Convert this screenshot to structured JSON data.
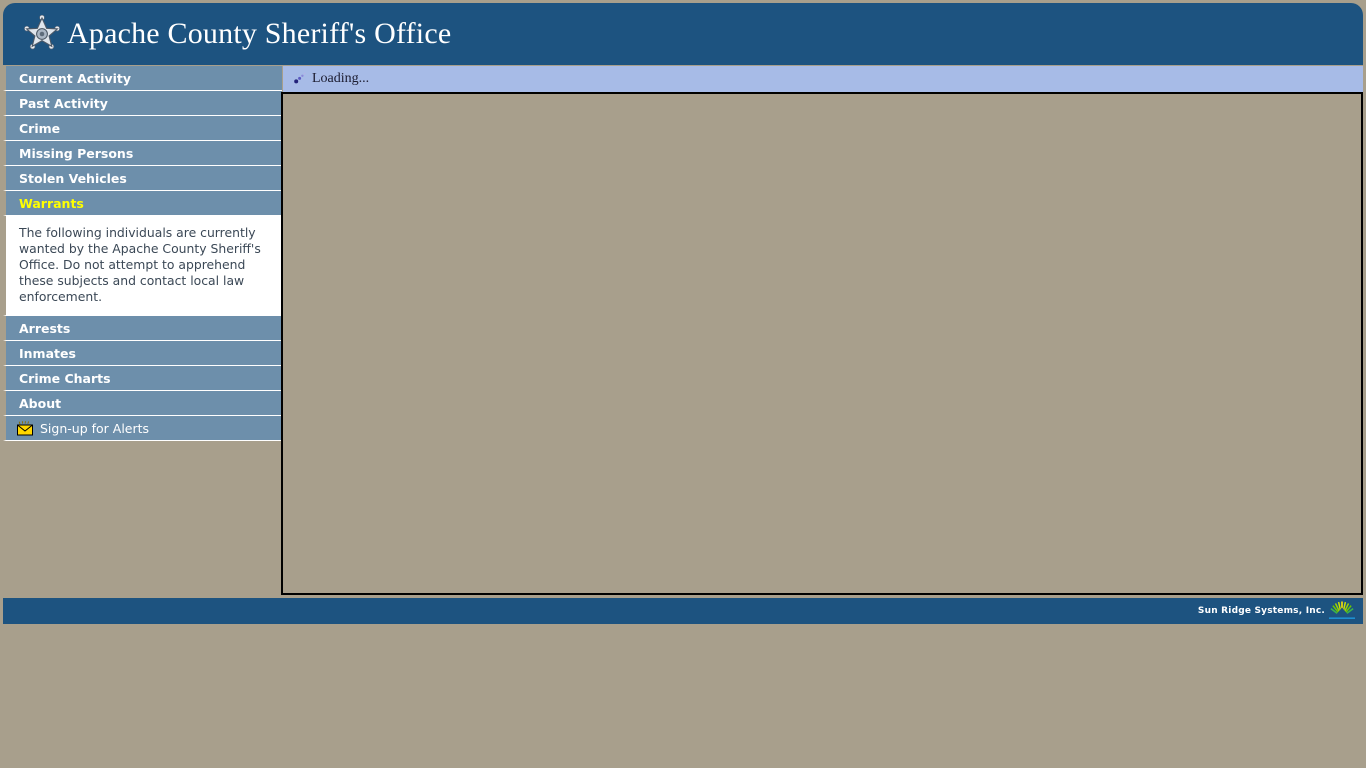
{
  "header": {
    "title": "Apache County Sheriff's Office",
    "badge_icon": "sheriff-star-badge-icon",
    "bg_color": "#1d5380"
  },
  "sidebar": {
    "items": [
      {
        "label": "Current Activity",
        "active": false
      },
      {
        "label": "Past Activity",
        "active": false
      },
      {
        "label": "Crime",
        "active": false
      },
      {
        "label": "Missing Persons",
        "active": false
      },
      {
        "label": "Stolen Vehicles",
        "active": false
      },
      {
        "label": "Warrants",
        "active": true
      }
    ],
    "blurb": "The following individuals are currently wanted by the Apache County Sheriff's Office. Do not attempt to apprehend these subjects and contact local law enforcement.",
    "items_after": [
      {
        "label": "Arrests",
        "active": false
      },
      {
        "label": "Inmates",
        "active": false
      },
      {
        "label": "Crime Charts",
        "active": false
      },
      {
        "label": "About",
        "active": false
      }
    ],
    "alerts": {
      "label": "Sign-up for Alerts",
      "icon": "envelope-alert-icon"
    },
    "item_bg_color": "#6d8fab",
    "active_text_color": "#ffff00"
  },
  "loading": {
    "text": "Loading...",
    "icon": "spinner-dots-icon",
    "bg_color": "#a7bbe7"
  },
  "content": {
    "bg_color": "#a89f8c",
    "border_color": "#000000"
  },
  "footer": {
    "text": "Sun Ridge Systems, Inc.",
    "logo_icon": "sunrise-logo-icon",
    "bg_color": "#1d5380"
  }
}
